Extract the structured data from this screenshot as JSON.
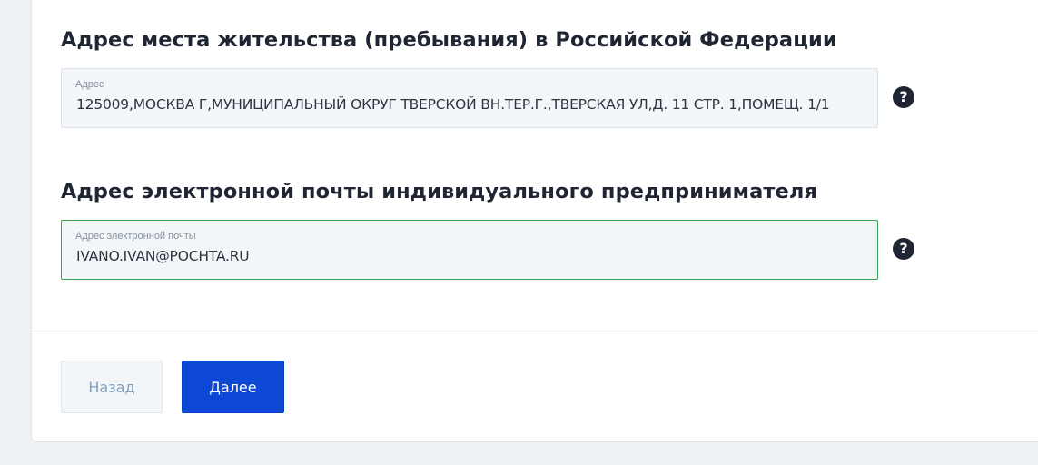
{
  "residence_section": {
    "title": "Адрес места жительства (пребывания) в Российской Федерации",
    "field_label": "Адрес",
    "field_value": "125009,МОСКВА Г,МУНИЦИПАЛЬНЫЙ ОКРУГ ТВЕРСКОЙ ВН.ТЕР.Г.,ТВЕРСКАЯ УЛ,Д. 11 СТР. 1,ПОМЕЩ. 1/1",
    "help_icon": "question-circle-icon",
    "help_glyph": "?"
  },
  "email_section": {
    "title": "Адрес электронной почты индивидуального предпринимателя",
    "field_label": "Адрес электронной почты",
    "field_value": "IVANO.IVAN@POCHTA.RU",
    "help_icon": "question-circle-icon",
    "help_glyph": "?"
  },
  "actions": {
    "back_label": "Назад",
    "next_label": "Далее"
  },
  "colors": {
    "primary_button": "#0c47d6",
    "active_field_border": "#38a24e",
    "help_icon_bg": "#1f2532",
    "page_background": "#eef1f4"
  }
}
